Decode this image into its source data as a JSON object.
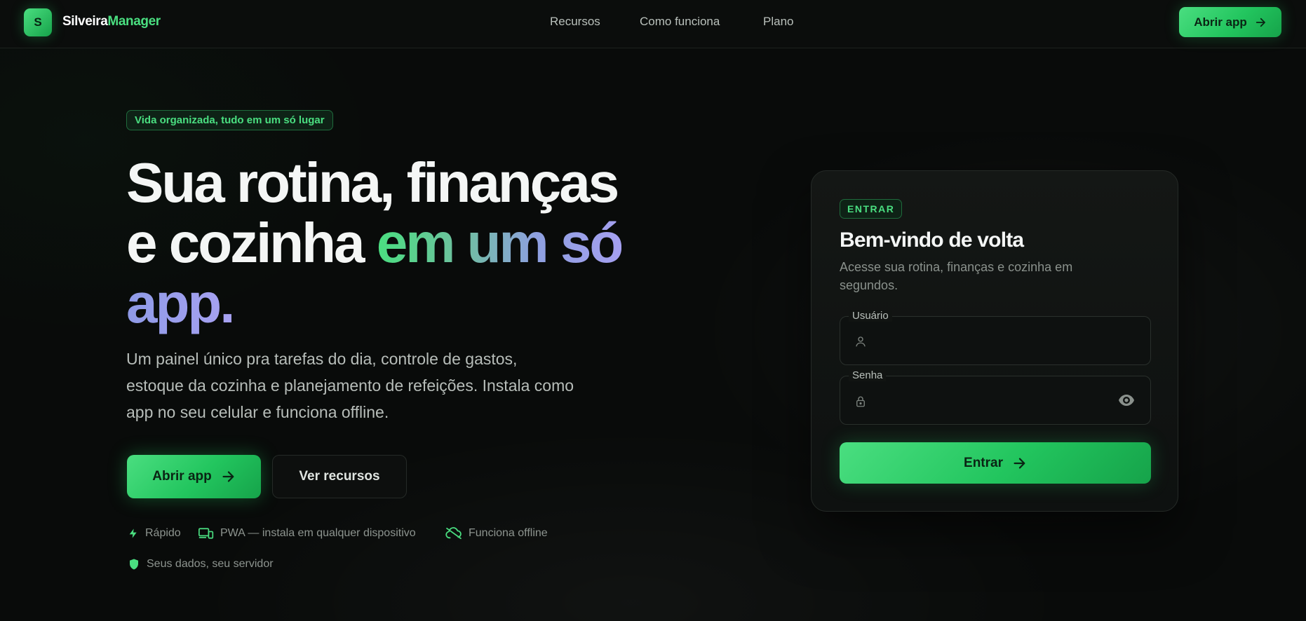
{
  "nav": {
    "logo_letter": "S",
    "brand_part1": "Silveira",
    "brand_part2": "Manager",
    "links": [
      "Recursos",
      "Como funciona",
      "Plano"
    ],
    "cta_label": "Abrir app"
  },
  "hero": {
    "pill": "Vida organizada, tudo em um só lugar",
    "headline_line1": "Sua rotina, finanças",
    "headline_line2_plain": "e cozinha ",
    "headline_line2_accent": "em um só",
    "headline_line3_accent": "app.",
    "subtitle": "Um painel único pra tarefas do dia, controle de gastos, estoque da cozinha e planejamento de refeições. Instala como app no seu celular e funciona offline.",
    "primary_button": "Abrir app",
    "secondary_button": "Ver recursos",
    "features": [
      {
        "icon": "bolt-icon",
        "label": "Rápido"
      },
      {
        "icon": "devices-icon",
        "label": "PWA — instala em qualquer dispositivo"
      },
      {
        "icon": "cloud-off-icon",
        "label": "Funciona offline"
      },
      {
        "icon": "shield-icon",
        "label": "Seus dados, seu servidor"
      }
    ]
  },
  "login": {
    "badge": "ENTRAR",
    "title": "Bem-vindo de volta",
    "subtitle": "Acesse sua rotina, finanças e cozinha em segundos.",
    "username_label": "Usuário",
    "username_value": "",
    "password_label": "Senha",
    "password_value": "",
    "submit_label": "Entrar"
  },
  "colors": {
    "accent": "#22c55e",
    "accent_light": "#4ade80",
    "background": "#090b0a",
    "card": "#121513"
  }
}
